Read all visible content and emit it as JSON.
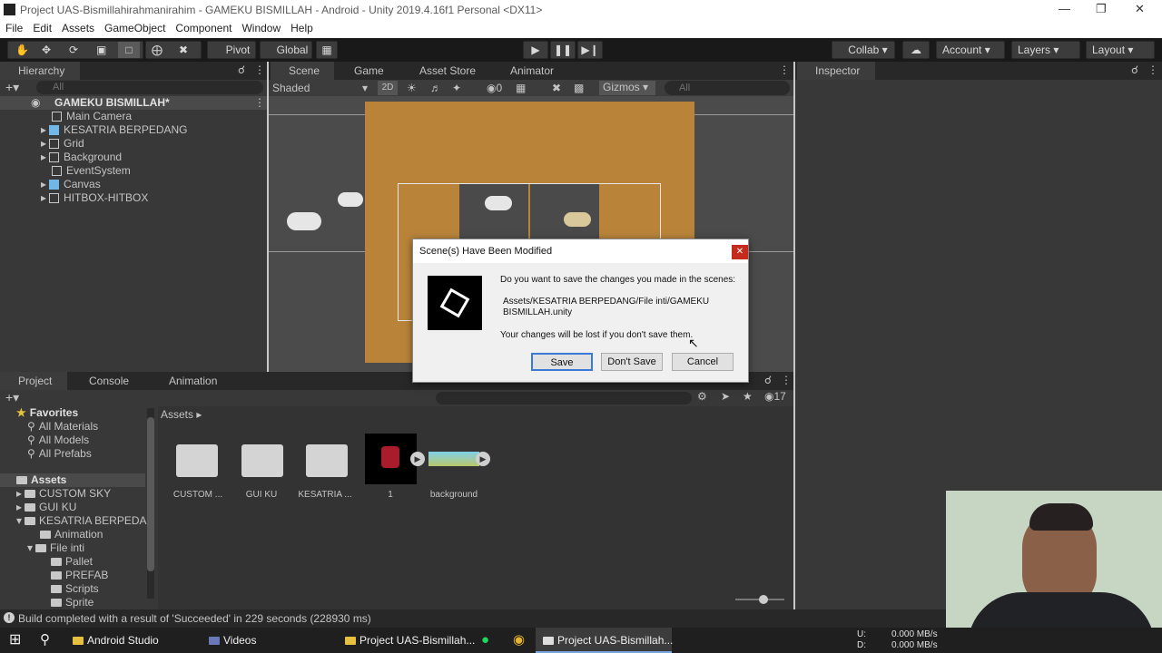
{
  "window": {
    "title": "Project UAS-Bismillahirahmanirahim - GAMEKU BISMILLAH - Android - Unity 2019.4.16f1 Personal <DX11>"
  },
  "menu": [
    "File",
    "Edit",
    "Assets",
    "GameObject",
    "Component",
    "Window",
    "Help"
  ],
  "toolbar": {
    "pivot": "Pivot",
    "global": "Global",
    "collab": "Collab",
    "account": "Account",
    "layers": "Layers",
    "layout": "Layout"
  },
  "hierarchy": {
    "tab": "Hierarchy",
    "search_placeholder": "All",
    "scene": "GAMEKU BISMILLAH*",
    "items": [
      "Main Camera",
      "KESATRIA BERPEDANG",
      "Grid",
      "Background",
      "EventSystem",
      "Canvas",
      "HITBOX-HITBOX"
    ]
  },
  "scene_tabs": [
    "Scene",
    "Game",
    "Asset Store",
    "Animator"
  ],
  "scene_toolbar": {
    "shading": "Shaded",
    "mode2d": "2D",
    "hidden_count": "0",
    "gizmos": "Gizmos",
    "search_placeholder": "All"
  },
  "inspector": {
    "tab": "Inspector"
  },
  "dialog": {
    "title": "Scene(s) Have Been Modified",
    "line1": "Do you want to save the changes you made in the scenes:",
    "path": "Assets/KESATRIA BERPEDANG/File inti/GAMEKU BISMILLAH.unity",
    "line2": "Your changes will be lost if you don't save them.",
    "save": "Save",
    "dont_save": "Don't Save",
    "cancel": "Cancel"
  },
  "project": {
    "tabs": [
      "Project",
      "Console",
      "Animation"
    ],
    "hidden_count": "17",
    "breadcrumb": "Assets",
    "favorites_header": "Favorites",
    "favorites": [
      "All Materials",
      "All Models",
      "All Prefabs"
    ],
    "assets_header": "Assets",
    "tree": [
      "CUSTOM SKY",
      "GUI KU",
      "KESATRIA BERPEDAN",
      "Animation",
      "File inti",
      "Pallet",
      "PREFAB",
      "Scripts",
      "Sprite"
    ],
    "grid": [
      "CUSTOM ...",
      "GUI KU",
      "KESATRIA ...",
      "1",
      "background"
    ]
  },
  "status": "Build completed with a result of 'Succeeded' in 229 seconds (228930 ms)",
  "taskbar": {
    "items": [
      "Android Studio",
      "Videos",
      "Project UAS-Bismillah...",
      "Project UAS-Bismillah..."
    ],
    "net_u_label": "U:",
    "net_u": "0.000 MB/s",
    "net_d_label": "D:",
    "net_d": "0.000 MB/s"
  },
  "colors": {
    "accent": "#3a79d6",
    "dialog_close": "#c42b1c",
    "ground": "#b9843a"
  }
}
